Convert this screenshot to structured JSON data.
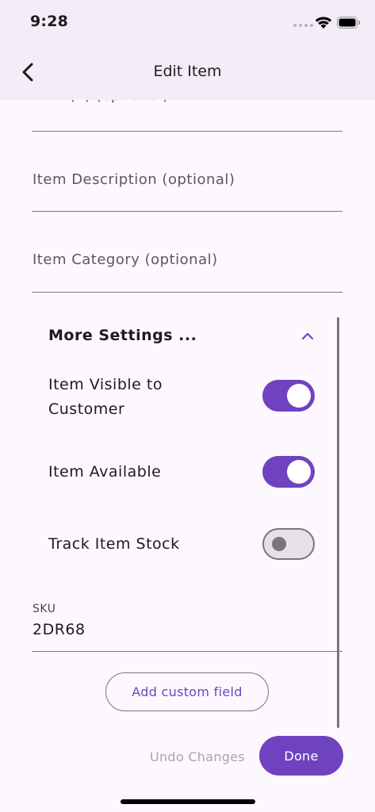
{
  "status_bar": {
    "time": "9:28",
    "icons": [
      "signal-dots-icon",
      "wifi-icon",
      "battery-icon"
    ]
  },
  "app_bar": {
    "title": "Edit Item",
    "back_icon": "chevron-left-icon"
  },
  "form": {
    "clipped_field_label": "MRP (₹) (optional)",
    "description_label": "Item Description (optional)",
    "category_label": "Item Category (optional)"
  },
  "settings": {
    "title": "More Settings ...",
    "expanded": true,
    "toggles": [
      {
        "label": "Item Visible to Customer",
        "on": true
      },
      {
        "label": "Item Available",
        "on": true
      },
      {
        "label": "Track Item Stock",
        "on": false
      }
    ],
    "sku": {
      "label": "SKU",
      "value": "2DR68"
    },
    "custom_field_button": "Add custom field"
  },
  "actions": {
    "undo_label": "Undo Changes",
    "done_label": "Done"
  },
  "colors": {
    "accent": "#6f43c0",
    "app_bar_bg": "#f2edf7",
    "page_bg": "#fdf8fd",
    "disabled_text": "#a8a5ad"
  }
}
